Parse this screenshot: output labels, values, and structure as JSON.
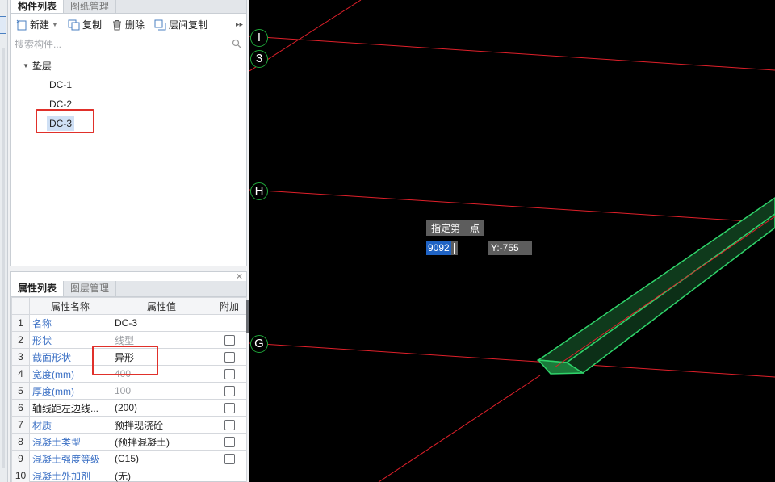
{
  "component_panel": {
    "tabs": [
      "构件列表",
      "图纸管理"
    ],
    "toolbar": {
      "new_label": "新建",
      "copy_label": "复制",
      "delete_label": "删除",
      "floor_copy_label": "层间复制"
    },
    "search_placeholder": "搜索构件...",
    "tree": {
      "root_label": "垫层",
      "items": [
        "DC-1",
        "DC-2",
        "DC-3"
      ],
      "selected": "DC-3"
    }
  },
  "property_panel": {
    "tabs": [
      "属性列表",
      "图层管理"
    ],
    "columns": [
      "属性名称",
      "属性值",
      "附加"
    ],
    "rows": [
      {
        "num": "1",
        "name": "名称",
        "value": "DC-3",
        "extra": false
      },
      {
        "num": "2",
        "name": "形状",
        "value": "线型",
        "extra": true
      },
      {
        "num": "3",
        "name": "截面形状",
        "value": "异形",
        "extra": true
      },
      {
        "num": "4",
        "name": "宽度(mm)",
        "value": "400",
        "extra": true
      },
      {
        "num": "5",
        "name": "厚度(mm)",
        "value": "100",
        "extra": true
      },
      {
        "num": "6",
        "name": "轴线距左边线...",
        "value": "(200)",
        "extra": true
      },
      {
        "num": "7",
        "name": "材质",
        "value": "预拌现浇砼",
        "extra": true
      },
      {
        "num": "8",
        "name": "混凝土类型",
        "value": "(预拌混凝土)",
        "extra": true
      },
      {
        "num": "9",
        "name": "混凝土强度等级",
        "value": "(C15)",
        "extra": true
      },
      {
        "num": "10",
        "name": "混凝土外加剂",
        "value": "(无)",
        "extra": false
      }
    ]
  },
  "viewport": {
    "axis_labels": [
      "I",
      "3",
      "H",
      "G"
    ],
    "prompt": "指定第一点",
    "x_value": "9092",
    "y_value": "Y:-755",
    "colors": {
      "grid_line": "#e0202a",
      "element": "#2fd36a",
      "background": "#000000"
    }
  }
}
